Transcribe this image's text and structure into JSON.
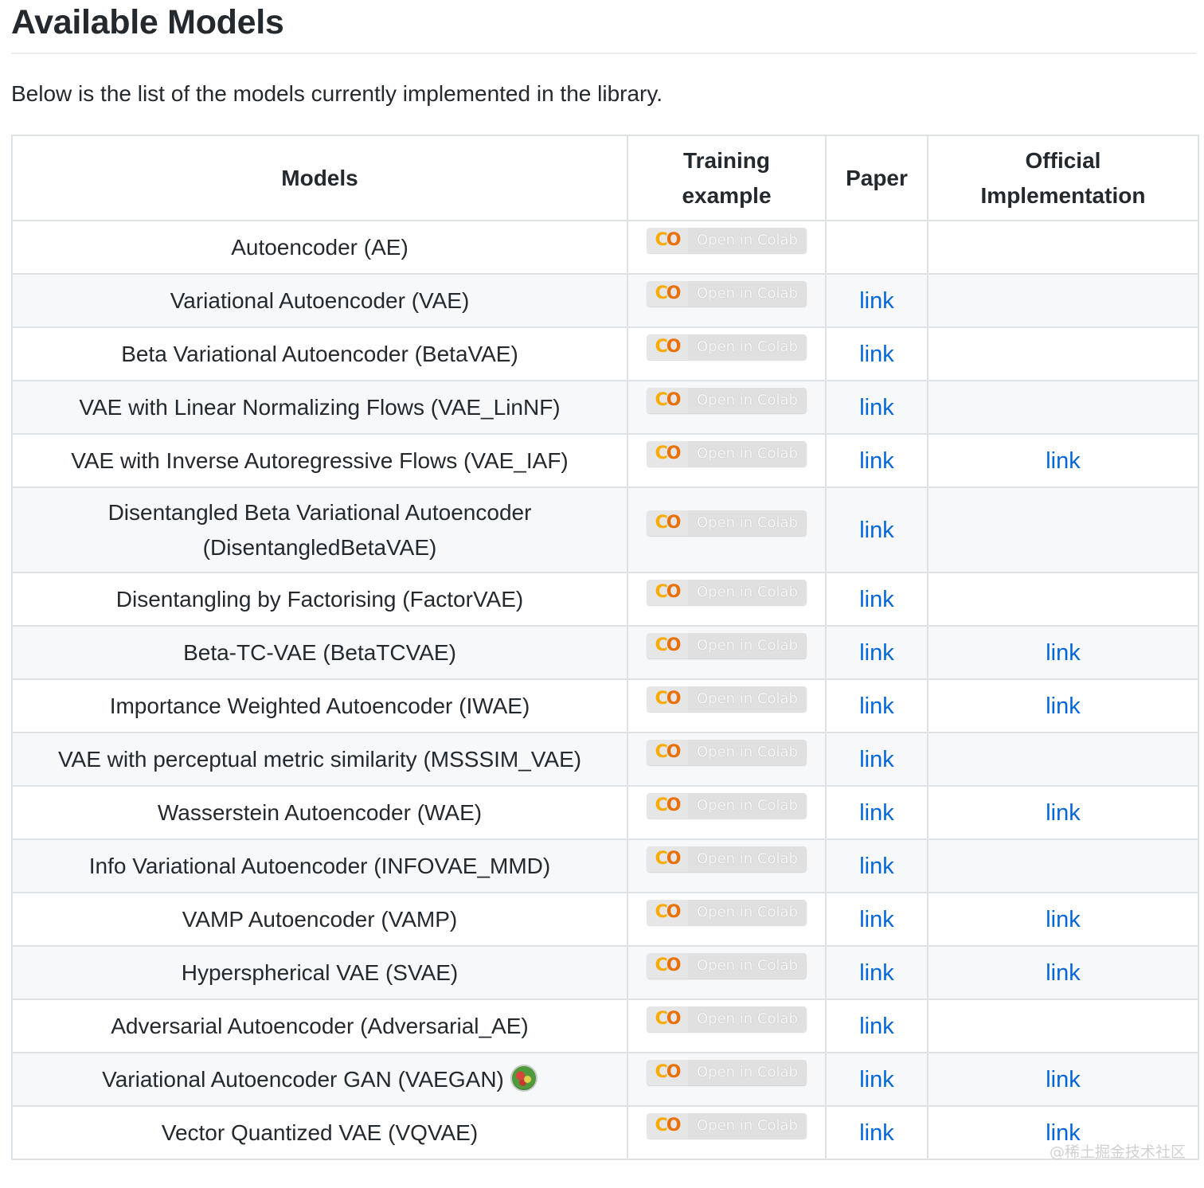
{
  "page": {
    "title": "Available Models",
    "intro": "Below is the list of the models currently implemented in the library."
  },
  "table": {
    "headers": {
      "models": "Models",
      "training_line1": "Training",
      "training_line2": "example",
      "paper": "Paper",
      "official_line1": "Official",
      "official_line2": "Implementation"
    },
    "badge": {
      "logo_c": "C",
      "logo_o": "O",
      "text": "Open in Colab",
      "logo_colors": [
        "#f9ab00",
        "#e8710a"
      ]
    },
    "link_color": "#0366d6",
    "rows": [
      {
        "model": "Autoencoder (AE)",
        "paper": "",
        "official": ""
      },
      {
        "model": "Variational Autoencoder (VAE)",
        "paper": "link",
        "official": ""
      },
      {
        "model": "Beta Variational Autoencoder (BetaVAE)",
        "paper": "link",
        "official": ""
      },
      {
        "model": "VAE with Linear Normalizing Flows (VAE_LinNF)",
        "paper": "link",
        "official": ""
      },
      {
        "model": "VAE with Inverse Autoregressive Flows (VAE_IAF)",
        "paper": "link",
        "official": "link"
      },
      {
        "model_line1": "Disentangled Beta Variational Autoencoder",
        "model_line2": "(DisentangledBetaVAE)",
        "paper": "link",
        "official": ""
      },
      {
        "model": "Disentangling by Factorising (FactorVAE)",
        "paper": "link",
        "official": ""
      },
      {
        "model": "Beta-TC-VAE (BetaTCVAE)",
        "paper": "link",
        "official": "link"
      },
      {
        "model": "Importance Weighted Autoencoder (IWAE)",
        "paper": "link",
        "official": "link"
      },
      {
        "model": "VAE with perceptual metric similarity (MSSSIM_VAE)",
        "paper": "link",
        "official": ""
      },
      {
        "model": "Wasserstein Autoencoder (WAE)",
        "paper": "link",
        "official": "link"
      },
      {
        "model": "Info Variational Autoencoder (INFOVAE_MMD)",
        "paper": "link",
        "official": ""
      },
      {
        "model": "VAMP Autoencoder (VAMP)",
        "paper": "link",
        "official": "link"
      },
      {
        "model": "Hyperspherical VAE (SVAE)",
        "paper": "link",
        "official": "link"
      },
      {
        "model": "Adversarial Autoencoder (Adversarial_AE)",
        "paper": "link",
        "official": ""
      },
      {
        "model": "Variational Autoencoder GAN (VAEGAN)",
        "model_icon": "salad-icon",
        "paper": "link",
        "official": "link"
      },
      {
        "model": "Vector Quantized VAE (VQVAE)",
        "paper": "link",
        "official": "link"
      }
    ]
  },
  "watermark": "@稀土掘金技术社区"
}
